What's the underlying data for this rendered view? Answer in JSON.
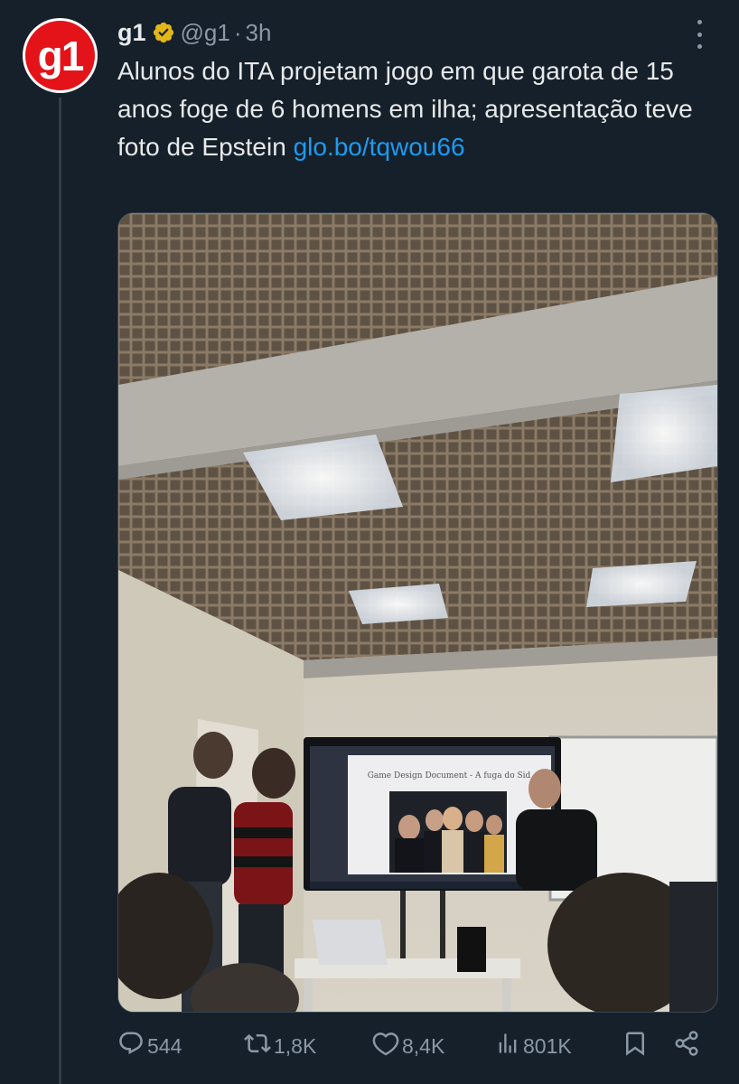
{
  "tweet": {
    "author_name": "g1",
    "avatar_text": "g1",
    "handle": "@g1",
    "separator": "·",
    "time": "3h",
    "text": "Alunos do ITA projetam jogo em que garota de 15 anos foge de 6 homens em ilha; apresentação teve foto de Epstein",
    "link": "glo.bo/tqwou66"
  },
  "media": {
    "screen_title": "Game Design Document - A fuga do Sid"
  },
  "actions": {
    "replies": "544",
    "retweets": "1,8K",
    "likes": "8,4K",
    "views": "801K"
  },
  "colors": {
    "background": "#15202b",
    "accent": "#1d9bf0",
    "muted": "#8b98a5",
    "verified": "#e2b719",
    "brand": "#e4131a"
  }
}
